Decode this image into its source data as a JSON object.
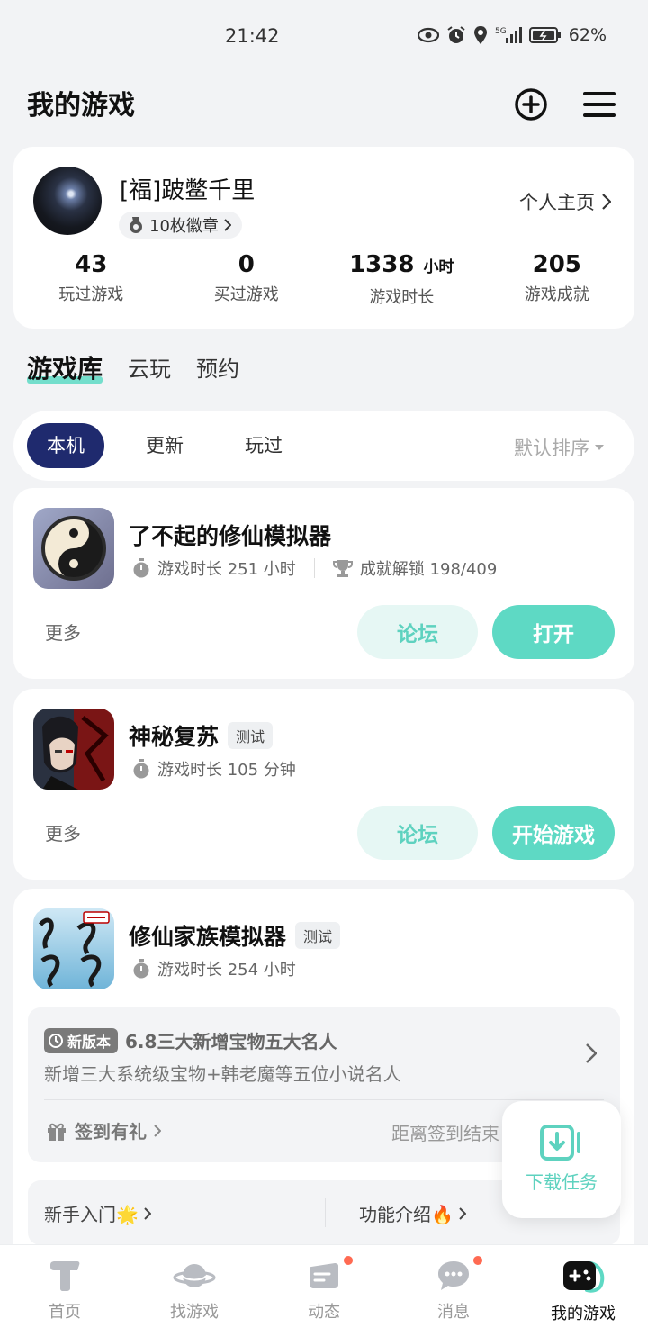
{
  "status": {
    "time": "21:42",
    "network": "5G",
    "battery": "62%"
  },
  "header": {
    "title": "我的游戏",
    "add_icon": "plus-circle-icon",
    "menu_icon": "hamburger-menu-icon"
  },
  "profile": {
    "username": "[福]跛鳖千里",
    "badges": "10枚徽章",
    "profile_link": "个人主页",
    "stats": [
      {
        "value": "43",
        "unit": "",
        "label": "玩过游戏"
      },
      {
        "value": "0",
        "unit": "",
        "label": "买过游戏"
      },
      {
        "value": "1338",
        "unit": "小时",
        "label": "游戏时长"
      },
      {
        "value": "205",
        "unit": "",
        "label": "游戏成就"
      }
    ]
  },
  "library_tabs": [
    "游戏库",
    "云玩",
    "预约"
  ],
  "filters": {
    "chips": [
      "本机",
      "更新",
      "玩过"
    ],
    "sort": "默认排序"
  },
  "games": [
    {
      "name": "了不起的修仙模拟器",
      "tag": "",
      "playtime": "游戏时长 251 小时",
      "achievement": "成就解锁 198/409",
      "more": "更多",
      "forum": "论坛",
      "action": "打开"
    },
    {
      "name": "神秘复苏",
      "tag": "测试",
      "playtime": "游戏时长 105 分钟",
      "more": "更多",
      "forum": "论坛",
      "action": "开始游戏"
    },
    {
      "name": "修仙家族模拟器",
      "tag": "测试",
      "playtime": "游戏时长 254 小时",
      "news_badge": "新版本",
      "news_title": "6.8三大新增宝物五大名人",
      "news_desc": "新增三大系统级宝物+韩老魔等五位小说名人",
      "checkin": "签到有礼",
      "checkin_end": "距离签到结束",
      "guide_left": "新手入门🌟",
      "guide_right": "功能介绍🔥"
    }
  ],
  "float_download": {
    "label": "下载任务"
  },
  "tabbar": [
    {
      "label": "首页",
      "icon": "home-icon"
    },
    {
      "label": "找游戏",
      "icon": "planet-icon"
    },
    {
      "label": "动态",
      "icon": "feed-icon"
    },
    {
      "label": "消息",
      "icon": "chat-bubble-icon"
    },
    {
      "label": "我的游戏",
      "icon": "gamepad-icon"
    }
  ],
  "colors": {
    "accent": "#5ed9c4",
    "chip_active": "#1f2a6e",
    "notification_dot": "#ff6a52",
    "background": "#f2f3f5"
  }
}
